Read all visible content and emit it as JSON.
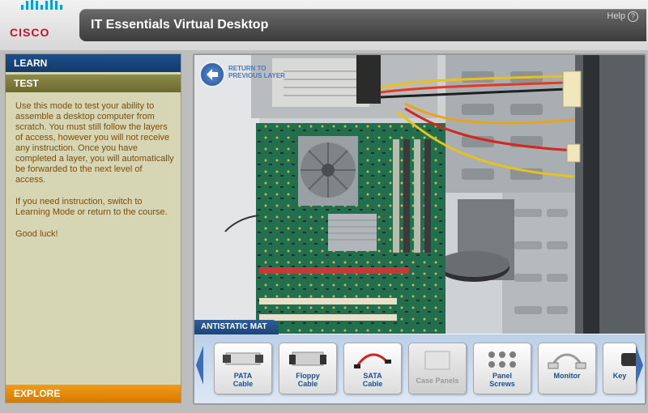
{
  "app": {
    "brand": "CISCO",
    "title": "IT Essentials Virtual Desktop",
    "help_label": "Help",
    "help_glyph": "?"
  },
  "sidebar": {
    "learn_label": "LEARN",
    "test_label": "TEST",
    "explore_label": "EXPLORE",
    "instructions": [
      "Use this mode to test your ability to assemble a desktop computer from scratch. You must still follow the layers of access, however you will not receive any instruction. Once you have completed a layer, you will automatically be forwarded to the next level of access.",
      "If you need instruction, switch to Learning Mode or return to the course.",
      "Good luck!"
    ]
  },
  "viewer": {
    "back_label_line1": "RETURN TO",
    "back_label_line2": "PREVIOUS LAYER"
  },
  "tray": {
    "title": "ANTISTATIC MAT",
    "parts": [
      {
        "label_line1": "PATA",
        "label_line2": "Cable",
        "icon": "pata-cable-icon",
        "enabled": true
      },
      {
        "label_line1": "Floppy",
        "label_line2": "Cable",
        "icon": "floppy-cable-icon",
        "enabled": true
      },
      {
        "label_line1": "SATA",
        "label_line2": "Cable",
        "icon": "sata-cable-icon",
        "enabled": true
      },
      {
        "label_line1": "Case Panels",
        "label_line2": "",
        "icon": "case-panels-icon",
        "enabled": false
      },
      {
        "label_line1": "Panel",
        "label_line2": "Screws",
        "icon": "panel-screws-icon",
        "enabled": true
      },
      {
        "label_line1": "Monitor",
        "label_line2": "",
        "icon": "monitor-cable-icon",
        "enabled": true
      },
      {
        "label_line1": "Key",
        "label_line2": "",
        "icon": "keyboard-icon",
        "enabled": true
      }
    ]
  },
  "colors": {
    "accent_blue": "#1d4f8c",
    "test_olive": "#7a7738",
    "explore_orange": "#f29b18",
    "brand_red": "#c8102e"
  }
}
